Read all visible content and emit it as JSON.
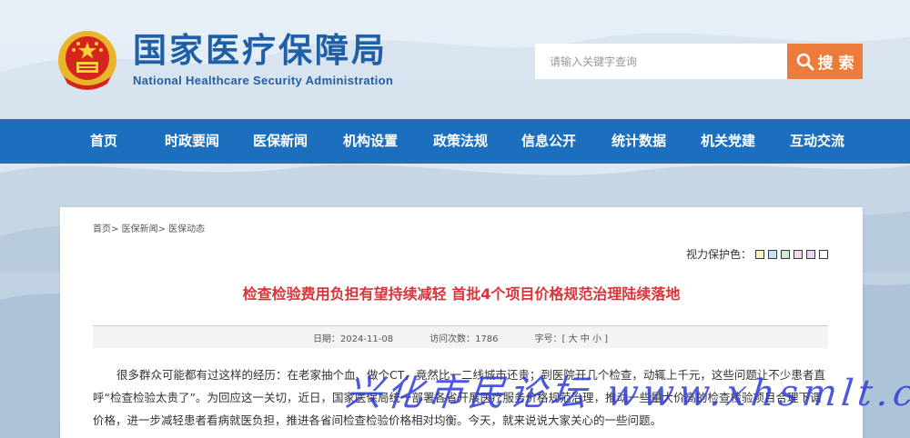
{
  "header": {
    "title_cn": "国家医疗保障局",
    "title_en": "National Healthcare Security Administration",
    "search": {
      "placeholder": "请输入关键字查询",
      "button_label": "搜 索"
    }
  },
  "nav": {
    "items": [
      {
        "label": "首页"
      },
      {
        "label": "时政要闻"
      },
      {
        "label": "医保新闻"
      },
      {
        "label": "机构设置"
      },
      {
        "label": "政策法规"
      },
      {
        "label": "信息公开"
      },
      {
        "label": "统计数据"
      },
      {
        "label": "机关党建"
      },
      {
        "label": "互动交流"
      }
    ]
  },
  "breadcrumb": {
    "items": [
      "首页",
      "医保新闻",
      "医保动态"
    ],
    "separator": ">"
  },
  "eye_protection": {
    "label": "视力保护色：",
    "colors": [
      "#fbf3c1",
      "#c9e3f4",
      "#d0ebd0",
      "#f7d6e6",
      "#e8daf2",
      "#ffffff"
    ]
  },
  "article": {
    "title": "检查检验费用负担有望持续减轻 首批4个项目价格规范治理陆续落地",
    "date_label": "日期：",
    "date": "2024-11-08",
    "views_label": "访问次数：",
    "views": "1786",
    "fontsize_label": "字号：",
    "fontsize_options": "[ 大 中 小 ]",
    "body": "很多群众可能都有过这样的经历：在老家抽个血、做个CT，竟然比一二线城市还贵；到医院开几个检查，动辄上千元，这些问题让不少患者直呼“检查检验太贵了”。为回应这一关切，近日，国家医保局统一部署各省开展医疗服务价格规范治理，推动一些量大价高的检查检验项目合理下调价格，进一步减轻患者看病就医负担，推进各省间检查检验价格相对均衡。今天，就来说说大家关心的一些问题。"
  },
  "watermark": "兴化市民论坛 www.xhsmlt.com"
}
